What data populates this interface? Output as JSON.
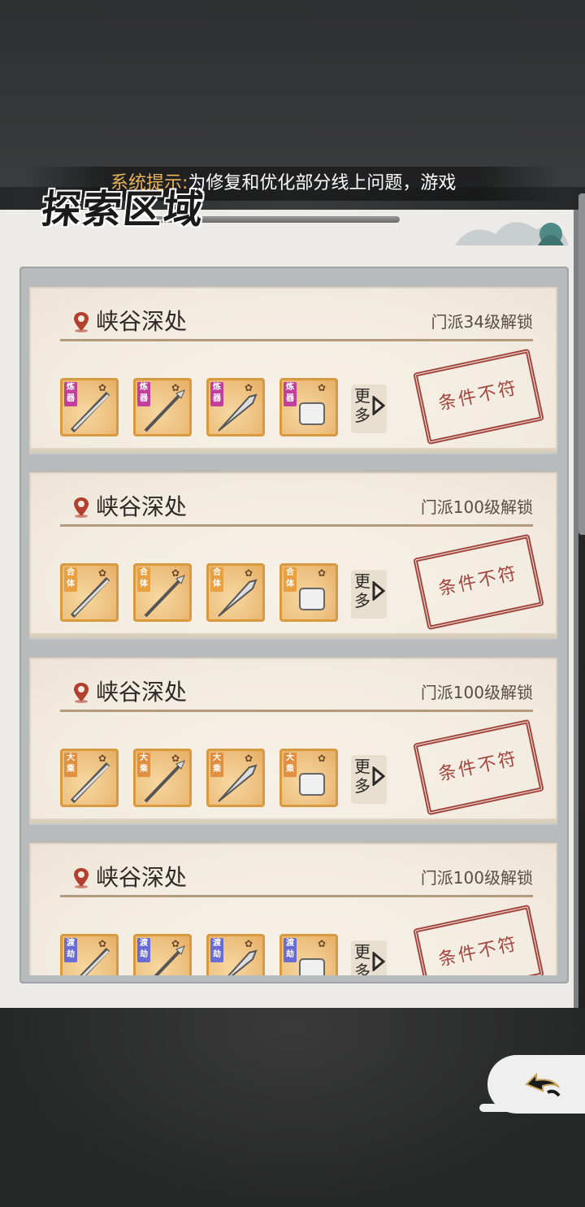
{
  "notice": {
    "prefix": "系统提示:",
    "text": "为修复和优化部分线上问题，游戏"
  },
  "header": {
    "title": "探索区域"
  },
  "more_label": "更多",
  "stamp_label": "条件不符",
  "zones": [
    {
      "name": "峡谷深处",
      "unlock": "门派34级解锁",
      "badge": "炼器",
      "badge_color": "#c23f9e",
      "items": [
        "sword",
        "spear",
        "blade",
        "stone"
      ]
    },
    {
      "name": "峡谷深处",
      "unlock": "门派100级解锁",
      "badge": "合体",
      "badge_color": "#e8a040",
      "items": [
        "sword",
        "spear",
        "blade",
        "stone"
      ]
    },
    {
      "name": "峡谷深处",
      "unlock": "门派100级解锁",
      "badge": "大乘",
      "badge_color": "#e09040",
      "items": [
        "sword",
        "spear",
        "blade",
        "stone"
      ]
    },
    {
      "name": "峡谷深处",
      "unlock": "门派100级解锁",
      "badge": "渡劫",
      "badge_color": "#6a6cd6",
      "items": [
        "sword",
        "spear",
        "blade",
        "stone"
      ]
    }
  ],
  "icons": {
    "location": "map-pin-icon",
    "back": "back-arrow-icon",
    "more": "triangle-right-icon"
  }
}
